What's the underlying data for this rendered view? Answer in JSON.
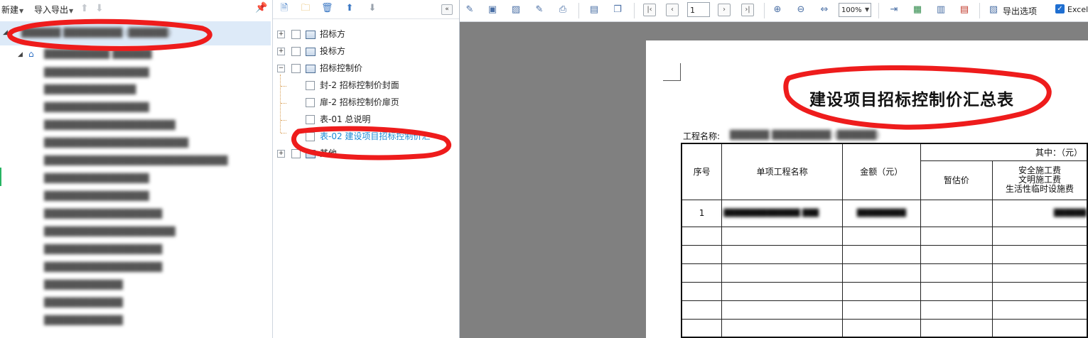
{
  "left_toolbar": {
    "new_label": "新建",
    "import_export_label": "导入导出"
  },
  "left_tree": {
    "project_label": "██████ █████████ (██████)",
    "root_label": "██████████ ██████",
    "items": [
      "████████████████",
      "██████████████",
      "████████████████",
      "████████████████████",
      "██████████████████████",
      "████████████████████████████",
      "████████████████",
      "████████████████",
      "██████████████████",
      "████████████████████",
      "██████████████████",
      "██████████████████",
      "████████████",
      "████████████",
      "████████████"
    ]
  },
  "middle_tree": {
    "nodes": [
      {
        "label": "招标方",
        "level": 0,
        "toggle": "+"
      },
      {
        "label": "投标方",
        "level": 0,
        "toggle": "+"
      },
      {
        "label": "招标控制价",
        "level": 0,
        "toggle": "-"
      },
      {
        "label": "封-2 招标控制价封面",
        "level": 1
      },
      {
        "label": "扉-2 招标控制价扉页",
        "level": 1
      },
      {
        "label": "表-01 总说明",
        "level": 1
      },
      {
        "label": "表-02 建设项目招标控制价汇",
        "level": 1,
        "selected": true
      },
      {
        "label": "其他",
        "level": 0,
        "toggle": "+"
      }
    ]
  },
  "right_toolbar": {
    "page_value": "1",
    "zoom_value": "100%",
    "export_options_label": "导出选项",
    "excel_label": "Excel"
  },
  "report": {
    "title": "建设项目招标控制价汇总表",
    "project_name_label": "工程名称:",
    "project_name_value": "██████ █████████ (██████)",
    "headers": {
      "seq": "序号",
      "name": "单项工程名称",
      "amount": "金额（元）",
      "among": "其中：（元）",
      "provisional": "暂估价",
      "safety_line1": "安全施工费",
      "safety_line2": "文明施工费",
      "safety_line3": "生活性临时设施费"
    },
    "rows": [
      {
        "seq": "1",
        "name": "██████████████ ███",
        "amount": "█████████",
        "provisional": "",
        "safety": "██████"
      }
    ]
  }
}
